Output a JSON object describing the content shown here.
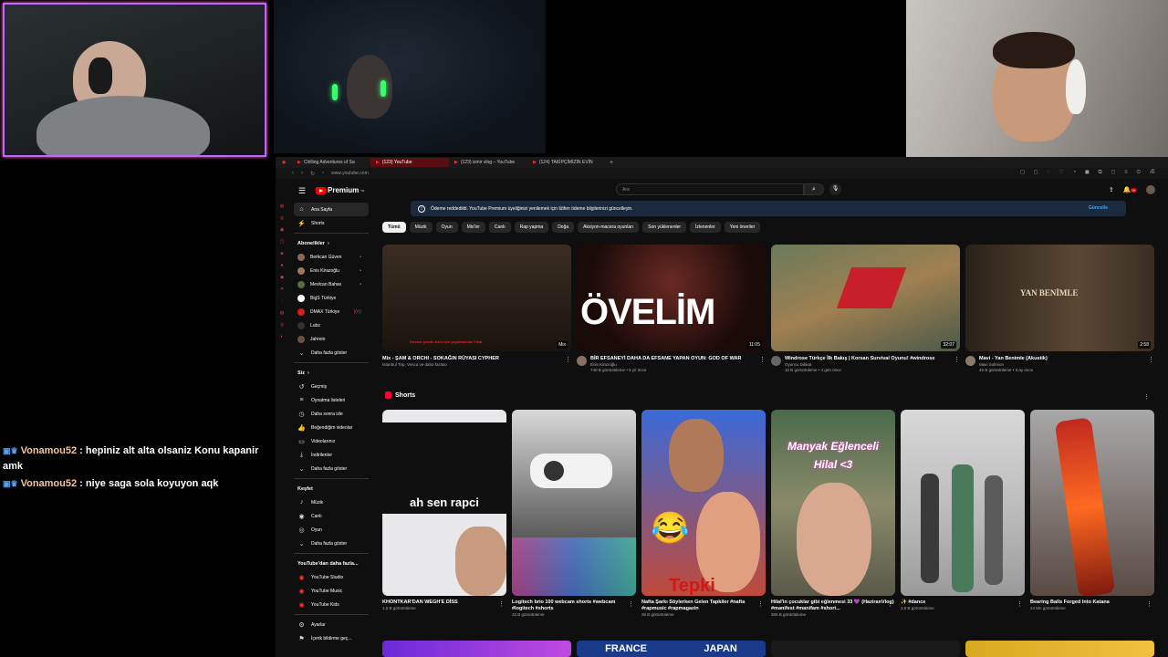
{
  "chat": [
    {
      "user": "Vonamou52",
      "message": ": hepiniz alt alta olsaniz Konu kapanir amk"
    },
    {
      "user": "Vonamou52",
      "message": ": niye saga sola koyuyon aqk"
    }
  ],
  "browser": {
    "tabs": [
      {
        "label": "Chilling Adventures of Sa",
        "active": false
      },
      {
        "label": "(123) YouTube",
        "active": true
      },
      {
        "label": "(123) izmir vlog – YouTube",
        "active": false
      },
      {
        "label": "(124) TAKİPÇİMİZİN EVİN",
        "active": false
      }
    ],
    "url": "www.youtube.com"
  },
  "youtube": {
    "logo_text": "Premium",
    "logo_sup": "TR",
    "search_placeholder": "Ara",
    "notif_count": "9+",
    "banner_text": "Ödeme reddedildi. YouTube Premium üyeliğinizi yenilemek için lütfen ödeme bilgilerinizi güncelleyin.",
    "banner_button": "Güncelle",
    "guide": {
      "home": "Ana Sayfa",
      "shorts": "Shorts",
      "subs_header": "Abonelikler",
      "subs": [
        {
          "name": "Berkcan Güven",
          "color": "#8a6a55",
          "live": true
        },
        {
          "name": "Enis Kirazoğlu",
          "color": "#a07560",
          "live": true
        },
        {
          "name": "Mevlcan Bahav",
          "color": "#5a6a45",
          "live": true
        },
        {
          "name": "BigS Türkiye",
          "color": "#ffffff",
          "live": false
        },
        {
          "name": "DMAX Türkiye",
          "color": "#d32020",
          "live": true
        },
        {
          "name": "Lubz",
          "color": "#333333",
          "live": false
        },
        {
          "name": "Jahrein",
          "color": "#705040",
          "live": false
        }
      ],
      "subs_more": "Daha fazla göster",
      "you_header": "Siz",
      "you": [
        "Geçmiş",
        "Oynatma listeleri",
        "Daha sonra izle",
        "Beğendiğim videolar",
        "Videolarınız",
        "İndirilenler",
        "Daha fazla göster"
      ],
      "explore_header": "Keşfet",
      "explore": [
        "Müzik",
        "Canlı",
        "Oyun",
        "Daha fazla göster"
      ],
      "more_header": "YouTube'dan daha fazla...",
      "more": [
        "YouTube Studio",
        "YouTube Music",
        "YouTube Kids"
      ],
      "settings": [
        "Ayarlar",
        "İçerik bildirme geç..."
      ]
    },
    "chips": [
      "Tümü",
      "Müzik",
      "Oyun",
      "Mix'ler",
      "Canlı",
      "Rap yapma",
      "Doğa",
      "Aksiyon-macera oyunları",
      "Son yüklenenler",
      "İzlenenler",
      "Yeni öneriler"
    ],
    "videos": [
      {
        "title": "Mix - ŞAM & ORCHI - SOKAĞIN RÜYASI CYPHER",
        "channel": "İstanbul Trip, Vesca ve daha fazlası",
        "meta": "",
        "duration": "Mix",
        "overlay": "Devam yeride sizin için yayınlanmaz Tıkla"
      },
      {
        "title": "BİR EFSANEYİ DAHA DA EFSANE YAPAN OYUN: GOD OF WAR",
        "channel": "Enis Kirazoğlu",
        "meta": "740 B görüntüleme • 6 yıl önce",
        "duration": "11:05",
        "overlay": "ÖVELİM"
      },
      {
        "title": "Windrose Türkçe İlk Bakış | Korsan Survival Oyunu! #windrose",
        "channel": "Oyuncu Dikkat",
        "meta": "10 B görüntüleme • 4 gün önce",
        "duration": "32:07",
        "overlay": ""
      },
      {
        "title": "Mavi - Yan Benimle (Akustik)",
        "channel": "Mavi Soltnion",
        "meta": "45 B görüntüleme • 3 ay önce",
        "duration": "2:58",
        "overlay": "YAN BENİMLE"
      }
    ],
    "shorts_header": "Shorts",
    "shorts": [
      {
        "title": "KHONTKAR'DAN WEGH'E DİSS",
        "meta": "1,5 B görüntüleme",
        "overlay": "ah sen rapci"
      },
      {
        "title": "Logitech brio 100 webcam shorts #webcam #logitech #shorts",
        "meta": "32 B görüntüleme",
        "overlay": ""
      },
      {
        "title": "Nafta Şarkı Söylerken Gelen Tapkiler #nafta #rapmusic #rapmagazin",
        "meta": "35 B görüntüleme",
        "overlay": "Tepki"
      },
      {
        "title": "Hilal'in çocuklar gibi eğlenmesi 33 💜 (HaziranVlog) #manifest #manifam #short...",
        "meta": "385 B görüntüleme",
        "overlay": "Manyak Eğlenceli Hilal <3"
      },
      {
        "title": "✨ #dance",
        "meta": "3,8 B görüntüleme",
        "overlay": ""
      },
      {
        "title": "Bearing Balls Forged Into Katana",
        "meta": "24 Mn görüntüleme",
        "overlay": ""
      }
    ],
    "bottom_labels": [
      "FRANCE",
      "JAPAN"
    ]
  }
}
